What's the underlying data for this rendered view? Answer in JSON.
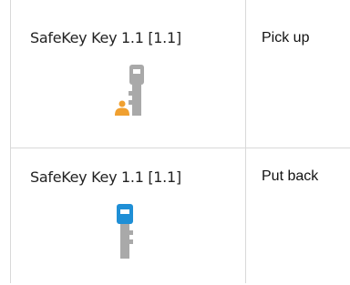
{
  "rows": [
    {
      "key_label": "SafeKey Key 1.1 [1.1]",
      "action": "Pick up",
      "icon": "key-with-person-icon",
      "key_color": "#a9a9a9",
      "person_color": "#f0a030"
    },
    {
      "key_label": "SafeKey Key 1.1 [1.1]",
      "action": "Put back",
      "icon": "key-blue-icon",
      "key_color": "#a9a9a9",
      "head_color": "#1f8fd6"
    }
  ]
}
